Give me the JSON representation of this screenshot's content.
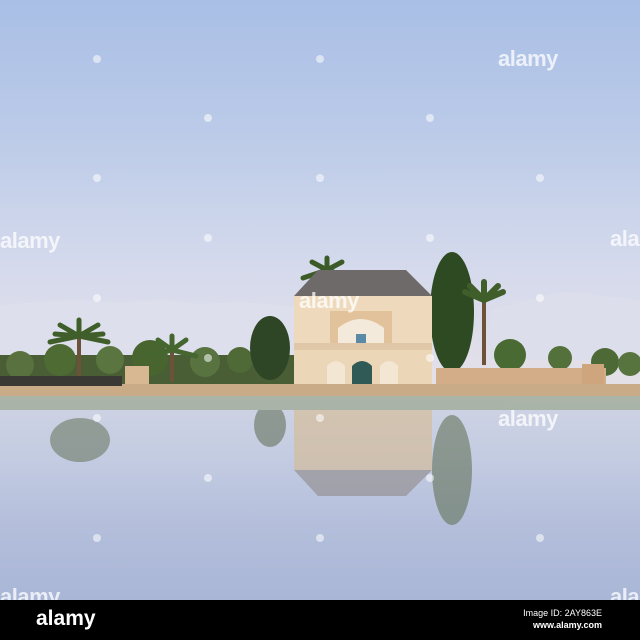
{
  "scene": {
    "subject": "pavilion-reflected-in-water",
    "sky_color": "#bccbe8",
    "water_color": "#c4cce2",
    "building_color": "#eed9bd",
    "roof_color": "#6e6a6a",
    "foliage_color": "#3d5a2a"
  },
  "watermark": {
    "text": "alamy"
  },
  "footer": {
    "logo": "alamy",
    "image_id": "Image ID: 2AY863E",
    "url": "www.alamy.com"
  }
}
